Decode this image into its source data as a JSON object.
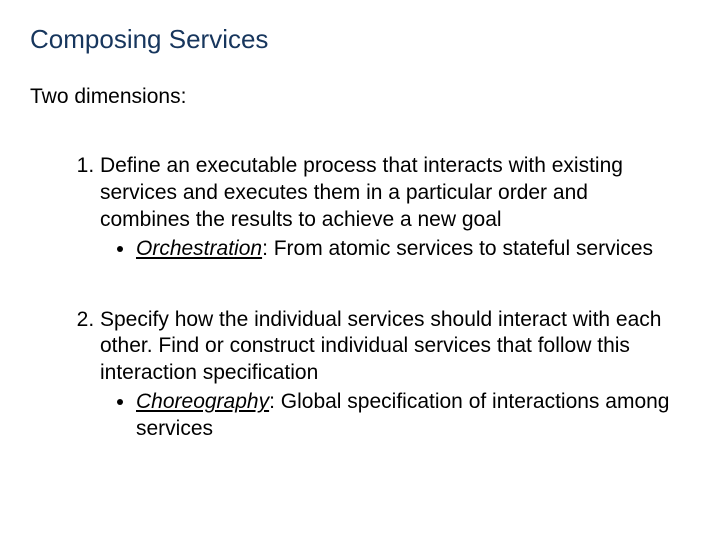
{
  "title": "Composing Services",
  "intro": "Two dimensions:",
  "items": [
    {
      "text": "Define an executable process that interacts with existing services and executes them in a particular order and combines the results to achieve a new goal",
      "bullet": {
        "term": "Orchestration",
        "rest": ": From atomic services to stateful services"
      }
    },
    {
      "text": "Specify how the individual services should interact with each other. Find or construct individual services that follow this interaction specification",
      "bullet": {
        "term": "Choreography",
        "rest": ": Global specification of interactions among services"
      }
    }
  ]
}
